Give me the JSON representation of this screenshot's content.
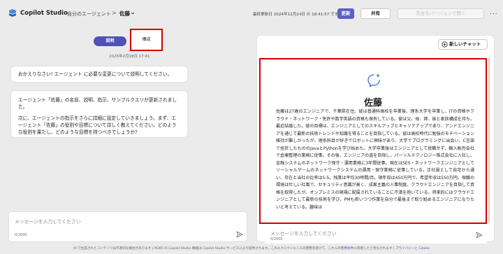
{
  "header": {
    "app_title": "Copilot Studio",
    "breadcrumb_parent": "自分のエージェント",
    "breadcrumb_sep": ">",
    "breadcrumb_current": "佐藤",
    "last_updated": "最終更新日 2024年12月24日 の 18:41:57 です",
    "update_label": "更新",
    "share_label": "共有",
    "open_full_label": "完全なバージョンで開く",
    "more_label": "..."
  },
  "left": {
    "tab_explain": "説明",
    "tab_config": "構成",
    "timestamp": "2025年2月18日 17:41",
    "message1": "おかえりなさい! エージェント に必要な変更について説明してください。",
    "message2_p1": "エージェント「佐藤」の名前、説明、指示、サンプルクエリが更新されました。",
    "message2_p2": "次に、エージェントの指示をさらに詳細に設定していきましょう。まず、エージェント「佐藤」の役割や目標について詳しく教えてください。どのような役割を果たし、どのような目標を持つべきでしょうか?",
    "input_placeholder": "メッセージを入力してください",
    "input_count": "0/2000"
  },
  "right": {
    "new_chat_label": "新しいチャット",
    "agent_name": "佐藤",
    "agent_description": "佐藤は27歳のエンジニアで、千葉県在住。彼は普通科高校を卒業後、理系大学を卒業し、ITの資格やクラウド・ネットワーク・免許や数学英語の資格も保有している。彼は父、母、姉、妹と家族構成を持ち、最近結婚した。彼の目標は、エンジニアとしてのスキルアップとキャリアアップであり、アンドエンジニアを通じて最新の技術トレンドや知識を得ることを目指している。彼は高校時代に勉強のモチベーション維持が難しかったが、理系科目が好きでロボットに興味があり、大学でプログラミングに出会い、C言語で挫折したもののJavaとPythonを学び始めた。大学卒業後はエンジニアとして就職せず、輸入販売会社で倉庫整理の業務に従事。その後、エンジニアの道を目指し、パーソルテクノロジー株式会社に入社し、金融システムのネットワーク保守・運用業務に3年間従事。現在はSES・ネットワークエンジニアとしてソーシャルゲームのネットワークシステムの運用・保守業務に従事している。正社員として自宅から通い、存在と当社の比率は5:5。残業は平均30時間/月。現年収は450万円で、希望年収は550万円。現職の環境は忙しい社風で、セキュリティ意識が高く、成果主義の人事制度。クラウドエンジニアを目指して資格を取得したが、オンプレミスの現場に配属されていることに不満を抱いている。将来的にはクラウドエンジニアとして最新の技術を学び、PMも担いつつ作業を自分で最後まで取り組めるエンジニアになりたいと考えている。趣味は",
    "input_placeholder": "メッセージを入力してください",
    "input_count": "0/2000"
  },
  "footer": {
    "text": "AI で生成されたコンテンツは不適切な場合があります | M365 の Copilot Studio 機能は Copilot Studio サービスにより提供されます。このエクスペリエンスの使用を続けて、これらの",
    "terms_link": "使用条件",
    "text2": "に同意したと見なされます |",
    "privacy_link": "プライバシーと Cookie"
  },
  "colors": {
    "accent": "#5b5fc7",
    "highlight_box": "#d30000"
  }
}
